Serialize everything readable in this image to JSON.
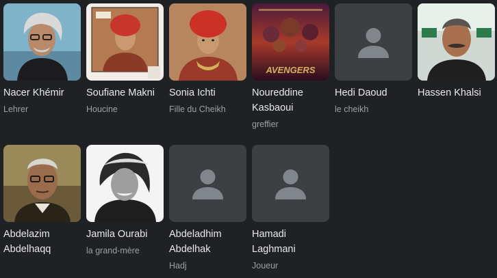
{
  "cast": [
    {
      "name": "Nacer Khémir",
      "role": "Lehrer",
      "photo": "portrait-grey-hair-glasses"
    },
    {
      "name": "Soufiane Makni",
      "role": "Houcine",
      "photo": "portrait-red-turban-boy"
    },
    {
      "name": "Sonia Ichti",
      "role": "Fille du Cheikh",
      "photo": "portrait-red-turban-girl"
    },
    {
      "name": "Noureddine Kasbaoui",
      "role": "greffier",
      "photo": "avengers-poster"
    },
    {
      "name": "Hedi Daoud",
      "role": "le cheikh",
      "photo": "placeholder-person-icon"
    },
    {
      "name": "Hassen Khalsi",
      "role": "",
      "photo": "portrait-mustache-man"
    },
    {
      "name": "Abdelazim Abdelhaqq",
      "role": "",
      "photo": "portrait-elderly-man-glasses"
    },
    {
      "name": "Jamila Ourabi",
      "role": "la grand-mère",
      "photo": "portrait-bw-woman"
    },
    {
      "name": "Abdeladhim Abdelhak",
      "role": "Hadj",
      "photo": "placeholder-person-icon"
    },
    {
      "name": "Hamadi Laghmani",
      "role": "Joueur",
      "photo": "placeholder-person-icon"
    }
  ],
  "poster_text": "AVENGERS"
}
